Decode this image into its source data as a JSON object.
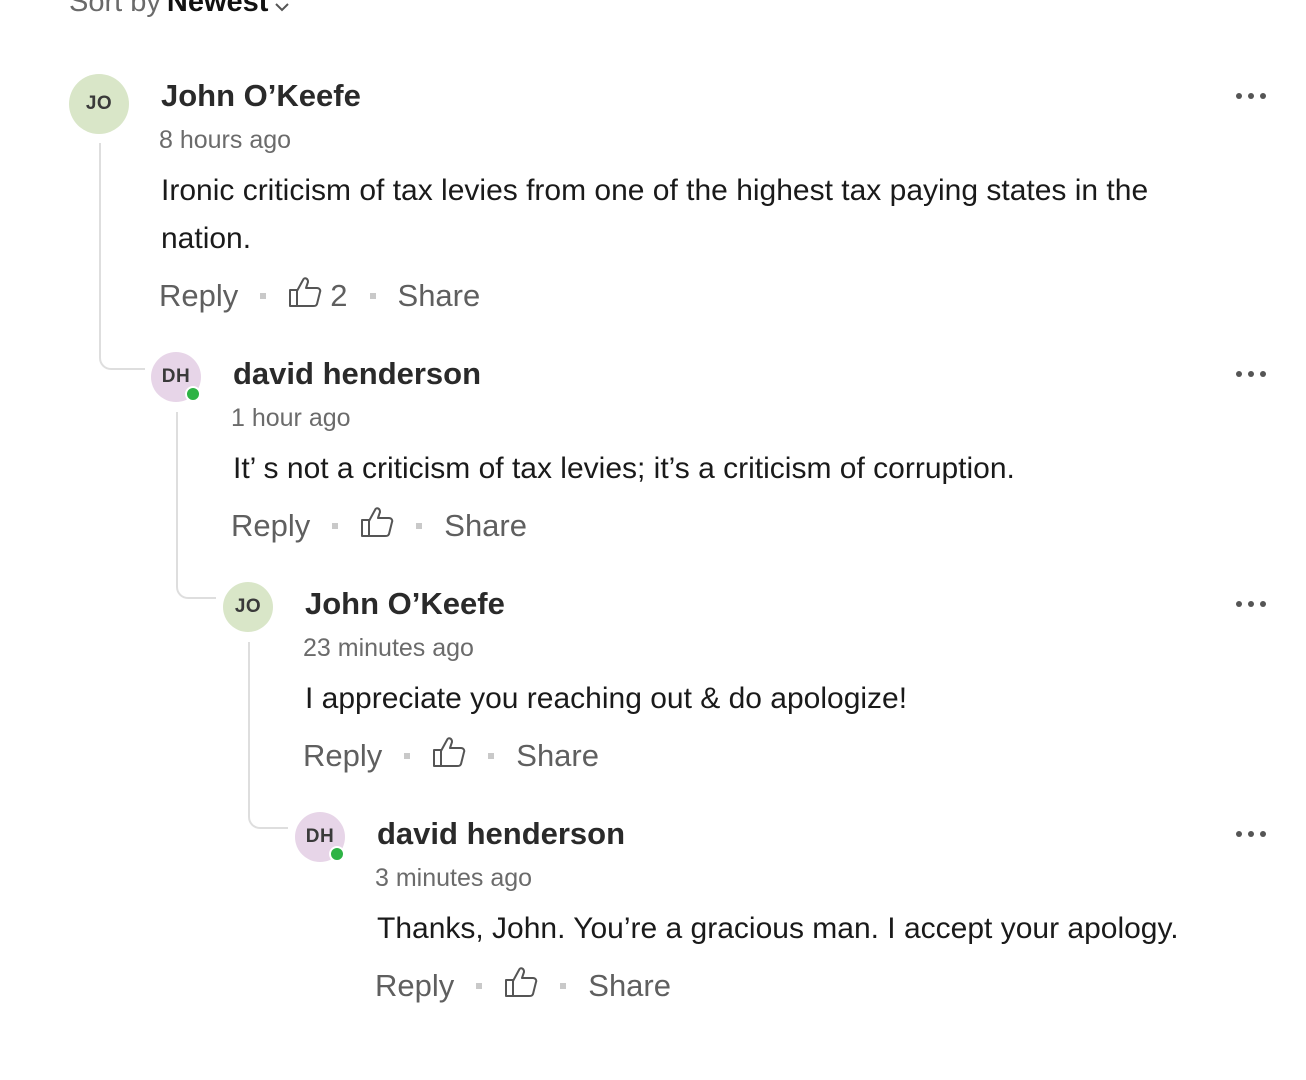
{
  "sort": {
    "prefix": "Sort by",
    "value": "Newest"
  },
  "comments": [
    {
      "initials": "JO",
      "author": "John O’Keefe",
      "time": "8 hours ago",
      "text": "Ironic criticism of tax levies from one of the highest tax paying states in the nation.",
      "reply_label": "Reply",
      "like_count": "2",
      "share_label": "Share"
    },
    {
      "initials": "DH",
      "author": "david henderson",
      "time": "1 hour ago",
      "text": "It’ s not a criticism of tax levies; it’s a criticism of corruption.",
      "reply_label": "Reply",
      "share_label": "Share"
    },
    {
      "initials": "JO",
      "author": "John O’Keefe",
      "time": "23 minutes ago",
      "text": "I appreciate you reaching out & do apologize!",
      "reply_label": "Reply",
      "share_label": "Share"
    },
    {
      "initials": "DH",
      "author": "david henderson",
      "time": "3 minutes ago",
      "text": "Thanks, John.  You’re a gracious man. I accept your apology.",
      "reply_label": "Reply",
      "share_label": "Share"
    }
  ],
  "colors": {
    "avatar_jo": "#d9e6c8",
    "avatar_dh": "#e7d5e8",
    "online": "#2eb345"
  },
  "icons": {
    "like": "thumbs-up-icon",
    "more": "more-options-icon",
    "sort": "chevron-down-icon"
  }
}
